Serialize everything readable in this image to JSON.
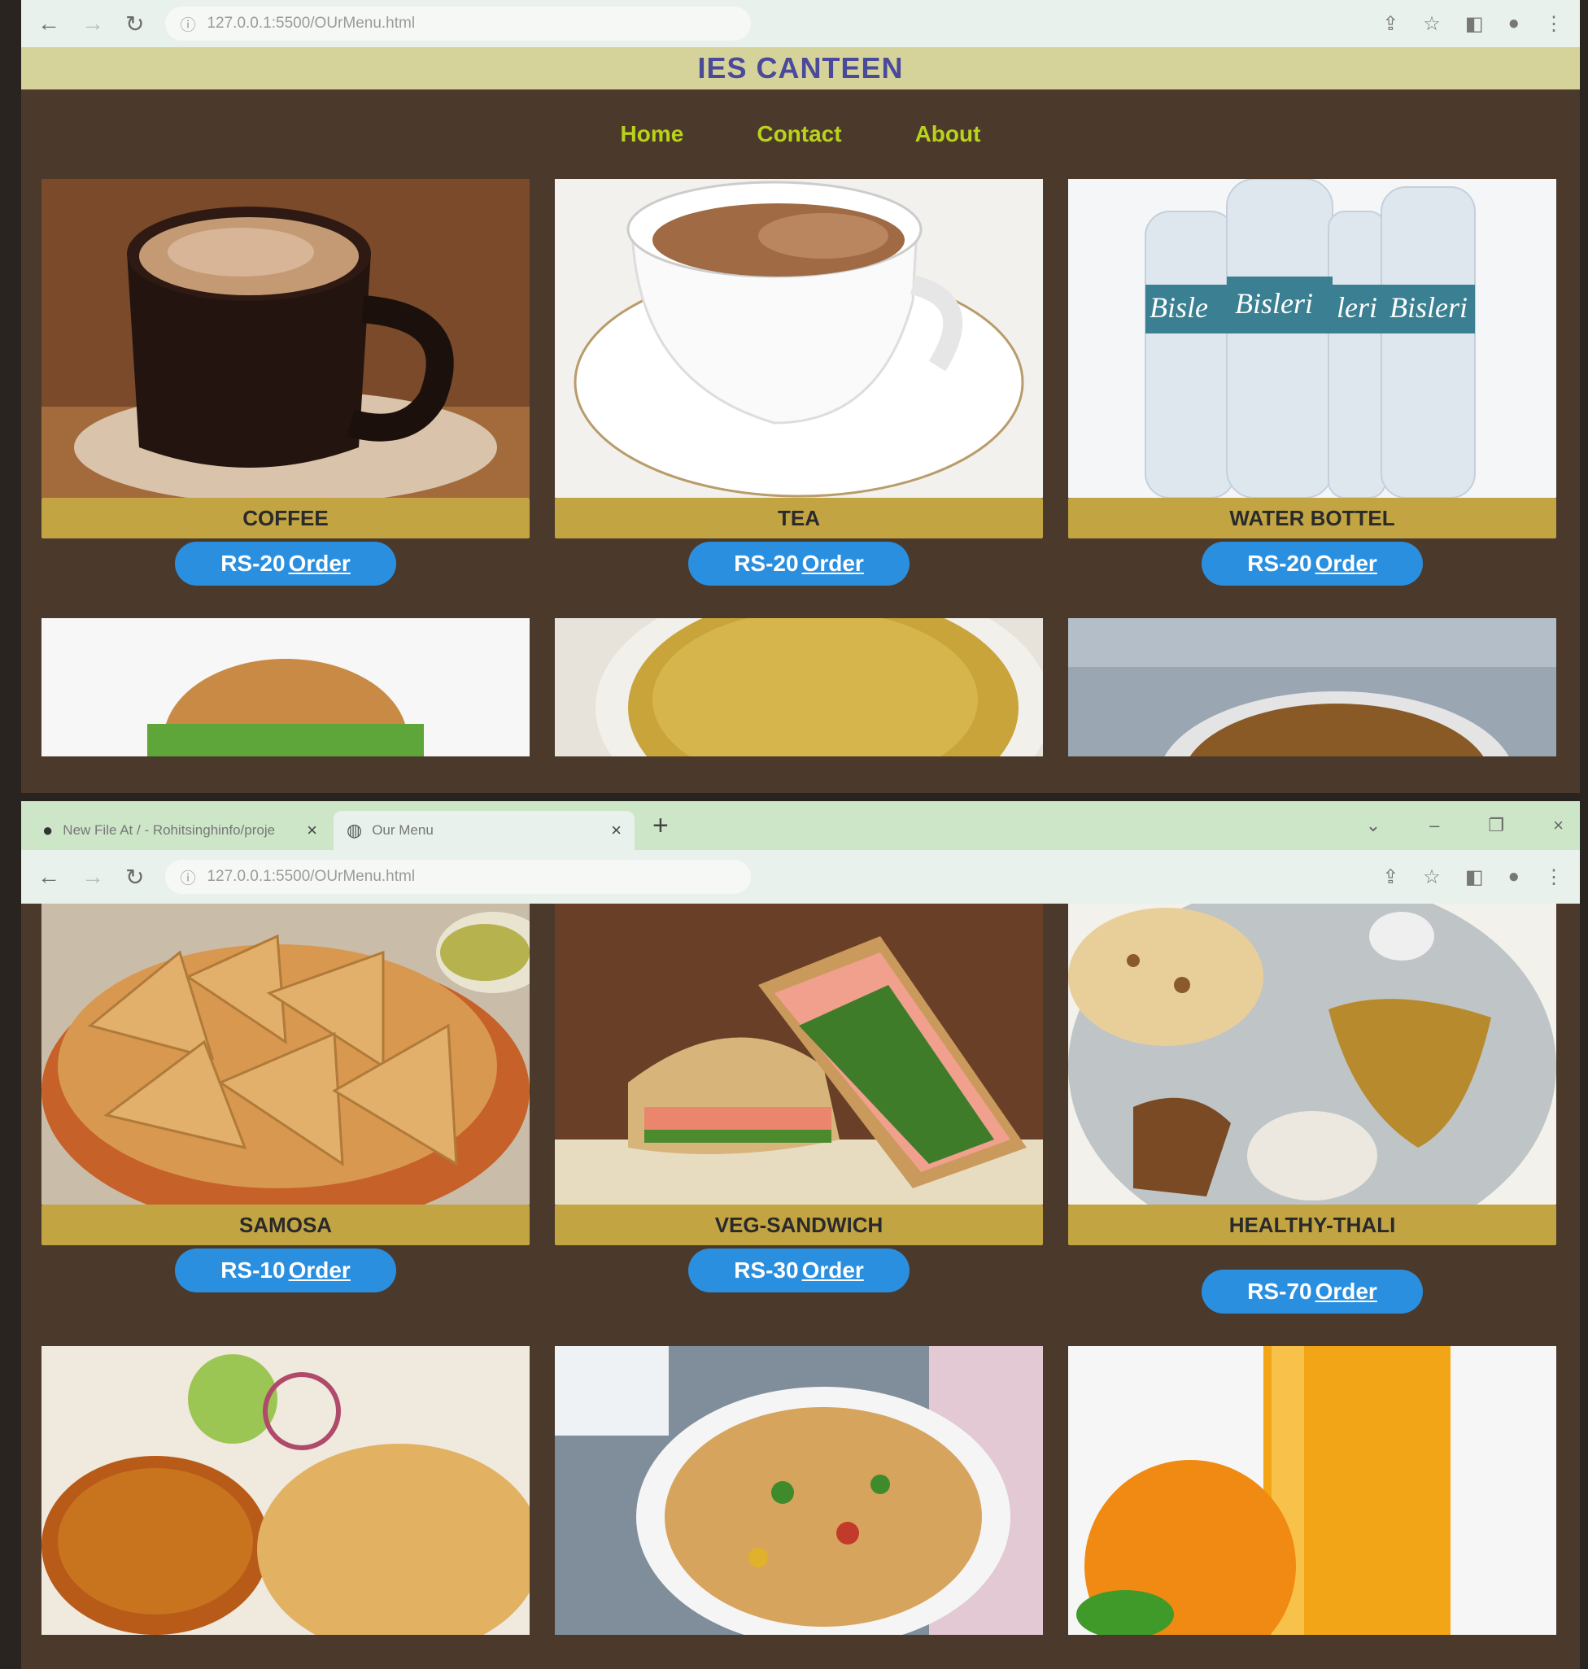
{
  "top_window": {
    "address": "127.0.0.1:5500/OUrMenu.html",
    "brand_title": "IES CANTEEN",
    "nav": [
      "Home",
      "Contact",
      "About"
    ],
    "items": [
      {
        "name": "COFFEE",
        "price": "RS-20",
        "order": "Order",
        "icon": "coffee-cup-image"
      },
      {
        "name": "TEA",
        "price": "RS-20",
        "order": "Order",
        "icon": "tea-cup-image"
      },
      {
        "name": "WATER BOTTEL",
        "price": "RS-20",
        "order": "Order",
        "icon": "water-bottles-image"
      }
    ],
    "partial_images": [
      "burger-image",
      "noodles-image",
      "chowmein-image"
    ]
  },
  "bottom_window": {
    "tabs": [
      {
        "label": "New File At / - Rohitsinghinfo/proje",
        "icon": "github-icon"
      },
      {
        "label": "Our Menu",
        "icon": "globe-icon"
      }
    ],
    "address": "127.0.0.1:5500/OUrMenu.html",
    "items": [
      {
        "name": "SAMOSA",
        "price": "RS-10",
        "order": "Order",
        "icon": "samosa-image"
      },
      {
        "name": "VEG-SANDWICH",
        "price": "RS-30",
        "order": "Order",
        "icon": "sandwich-image"
      },
      {
        "name": "HEALTHY-THALI",
        "price": "RS-70",
        "order": "Order",
        "icon": "thali-image"
      }
    ],
    "partial_images": [
      "chole-bhature-image",
      "pasta-salad-image",
      "orange-juice-image"
    ]
  },
  "colors": {
    "page_bg": "#4b3a2c",
    "nav_link": "#b9d21a",
    "brand_text": "#4a4a9a",
    "label_bar": "#c2a443",
    "order_button": "#2b8fe0"
  }
}
